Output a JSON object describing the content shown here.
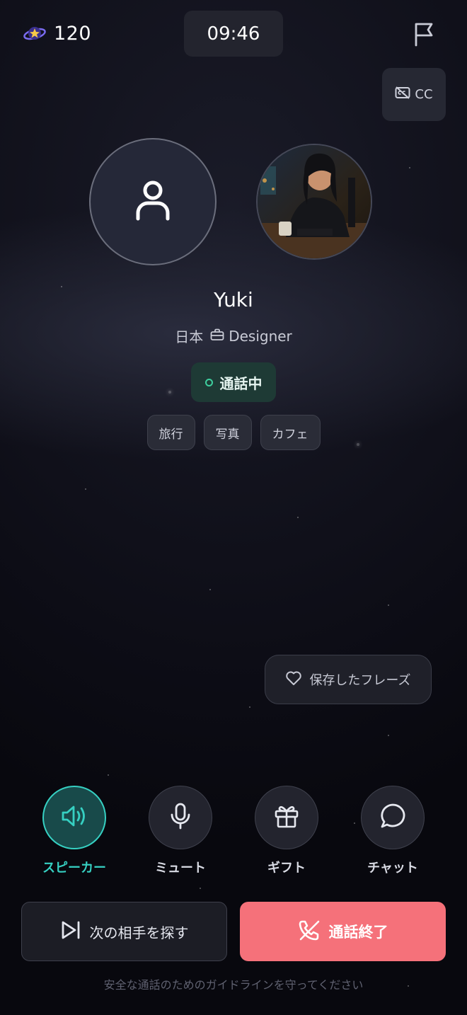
{
  "header": {
    "coins": "120",
    "timer": "09:46",
    "cc_label": "CC"
  },
  "peer": {
    "name": "Yuki",
    "country": "日本",
    "occupation": "Designer",
    "status": "通話中",
    "tags": [
      "旅行",
      "写真",
      "カフェ"
    ]
  },
  "saved_phrases_label": "保存したフレーズ",
  "controls": {
    "speaker": "スピーカー",
    "mute": "ミュート",
    "gift": "ギフト",
    "chat": "チャット"
  },
  "actions": {
    "next_label": "次の相手を探す",
    "end_label": "通話終了"
  },
  "footer": {
    "guideline": "安全な通話のためのガイドラインを守ってください"
  },
  "colors": {
    "accent_teal": "#36d0c2",
    "end_call_red": "#f5717a",
    "status_green": "#3ecf9e"
  }
}
